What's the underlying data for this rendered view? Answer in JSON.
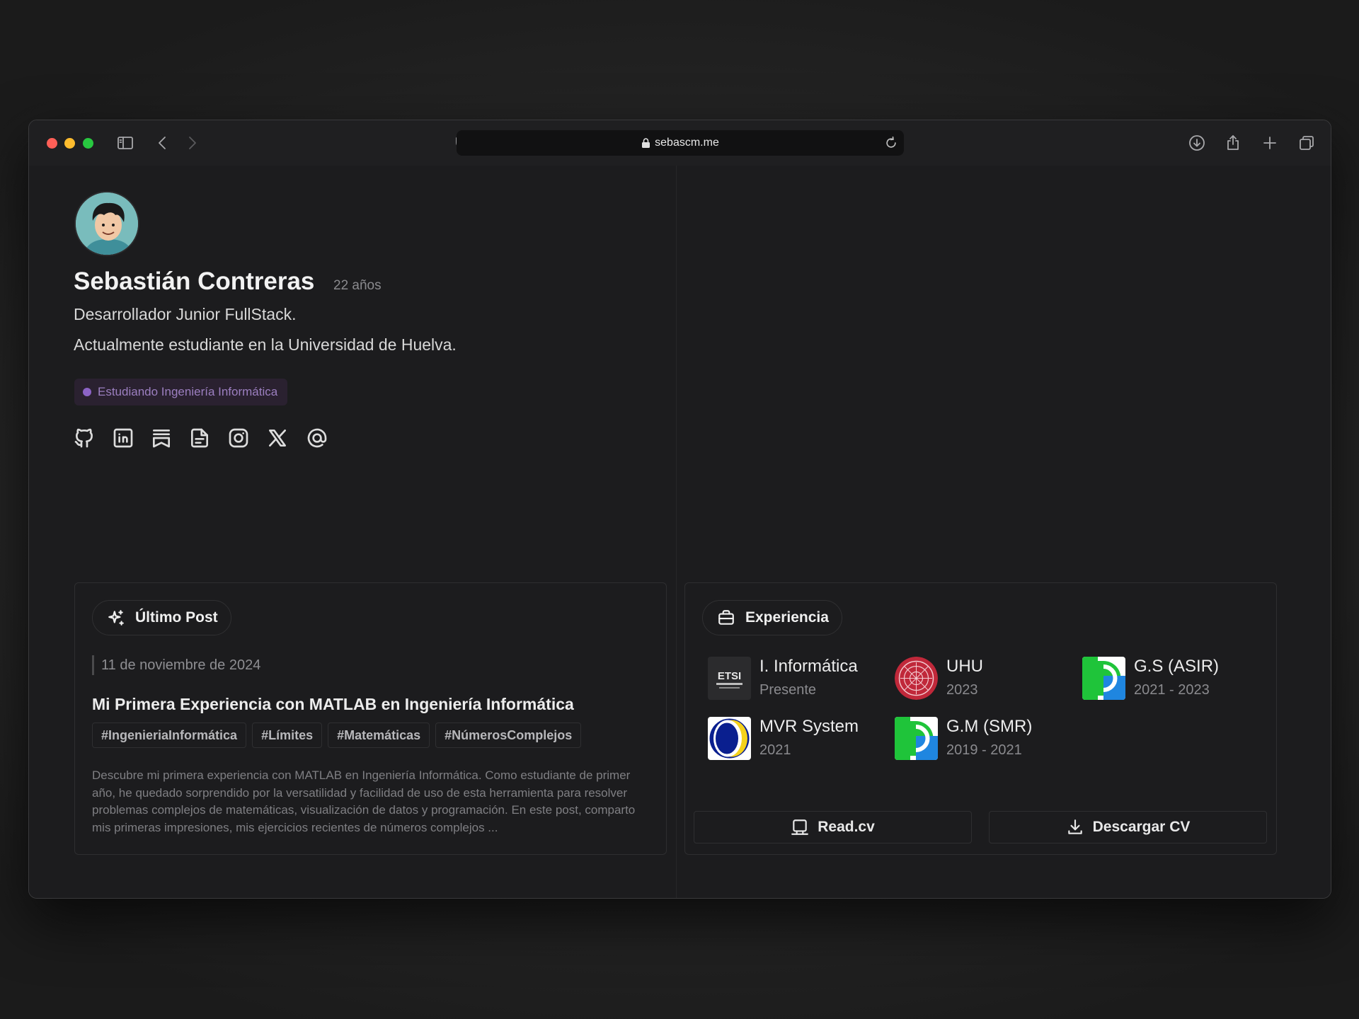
{
  "browser": {
    "url": "sebascm.me"
  },
  "profile": {
    "name": "Sebastián Contreras",
    "age": "22 años",
    "role": "Desarrollador Junior FullStack.",
    "bio": "Actualmente estudiante en la Universidad de Huelva.",
    "status": "Estudiando Ingeniería Informática",
    "status_color": "#8c63c6",
    "socials": [
      {
        "icon": "github-icon"
      },
      {
        "icon": "linkedin-icon"
      },
      {
        "icon": "bookmark-icon"
      },
      {
        "icon": "document-icon"
      },
      {
        "icon": "instagram-icon"
      },
      {
        "icon": "x-icon"
      },
      {
        "icon": "at-sign-icon"
      }
    ]
  },
  "post": {
    "section_label": "Último Post",
    "date": "11 de noviembre de 2024",
    "title": "Mi Primera Experiencia con MATLAB en Ingeniería Informática",
    "tags": [
      "#IngenieriaInformática",
      "#Límites",
      "#Matemáticas",
      "#NúmerosComplejos"
    ],
    "description": "Descubre mi primera experiencia con MATLAB en Ingeniería Informática. Como estudiante de primer año, he quedado sorprendido por la versatilidad y facilidad de uso de esta herramienta para resolver problemas complejos de matemáticas, visualización de datos y programación. En este post, comparto mis primeras impresiones, mis ejercicios recientes de números complejos ..."
  },
  "experience": {
    "section_label": "Experiencia",
    "items": [
      {
        "title": "I. Informática",
        "subtitle": "Presente"
      },
      {
        "title": "UHU",
        "subtitle": "2023"
      },
      {
        "title": "G.S (ASIR)",
        "subtitle": "2021 - 2023"
      },
      {
        "title": "MVR System",
        "subtitle": "2021"
      },
      {
        "title": "G.M (SMR)",
        "subtitle": "2019 - 2021"
      }
    ],
    "logo_text": "ETSI",
    "read_cv_label": "Read.cv",
    "download_cv_label": "Descargar CV"
  }
}
